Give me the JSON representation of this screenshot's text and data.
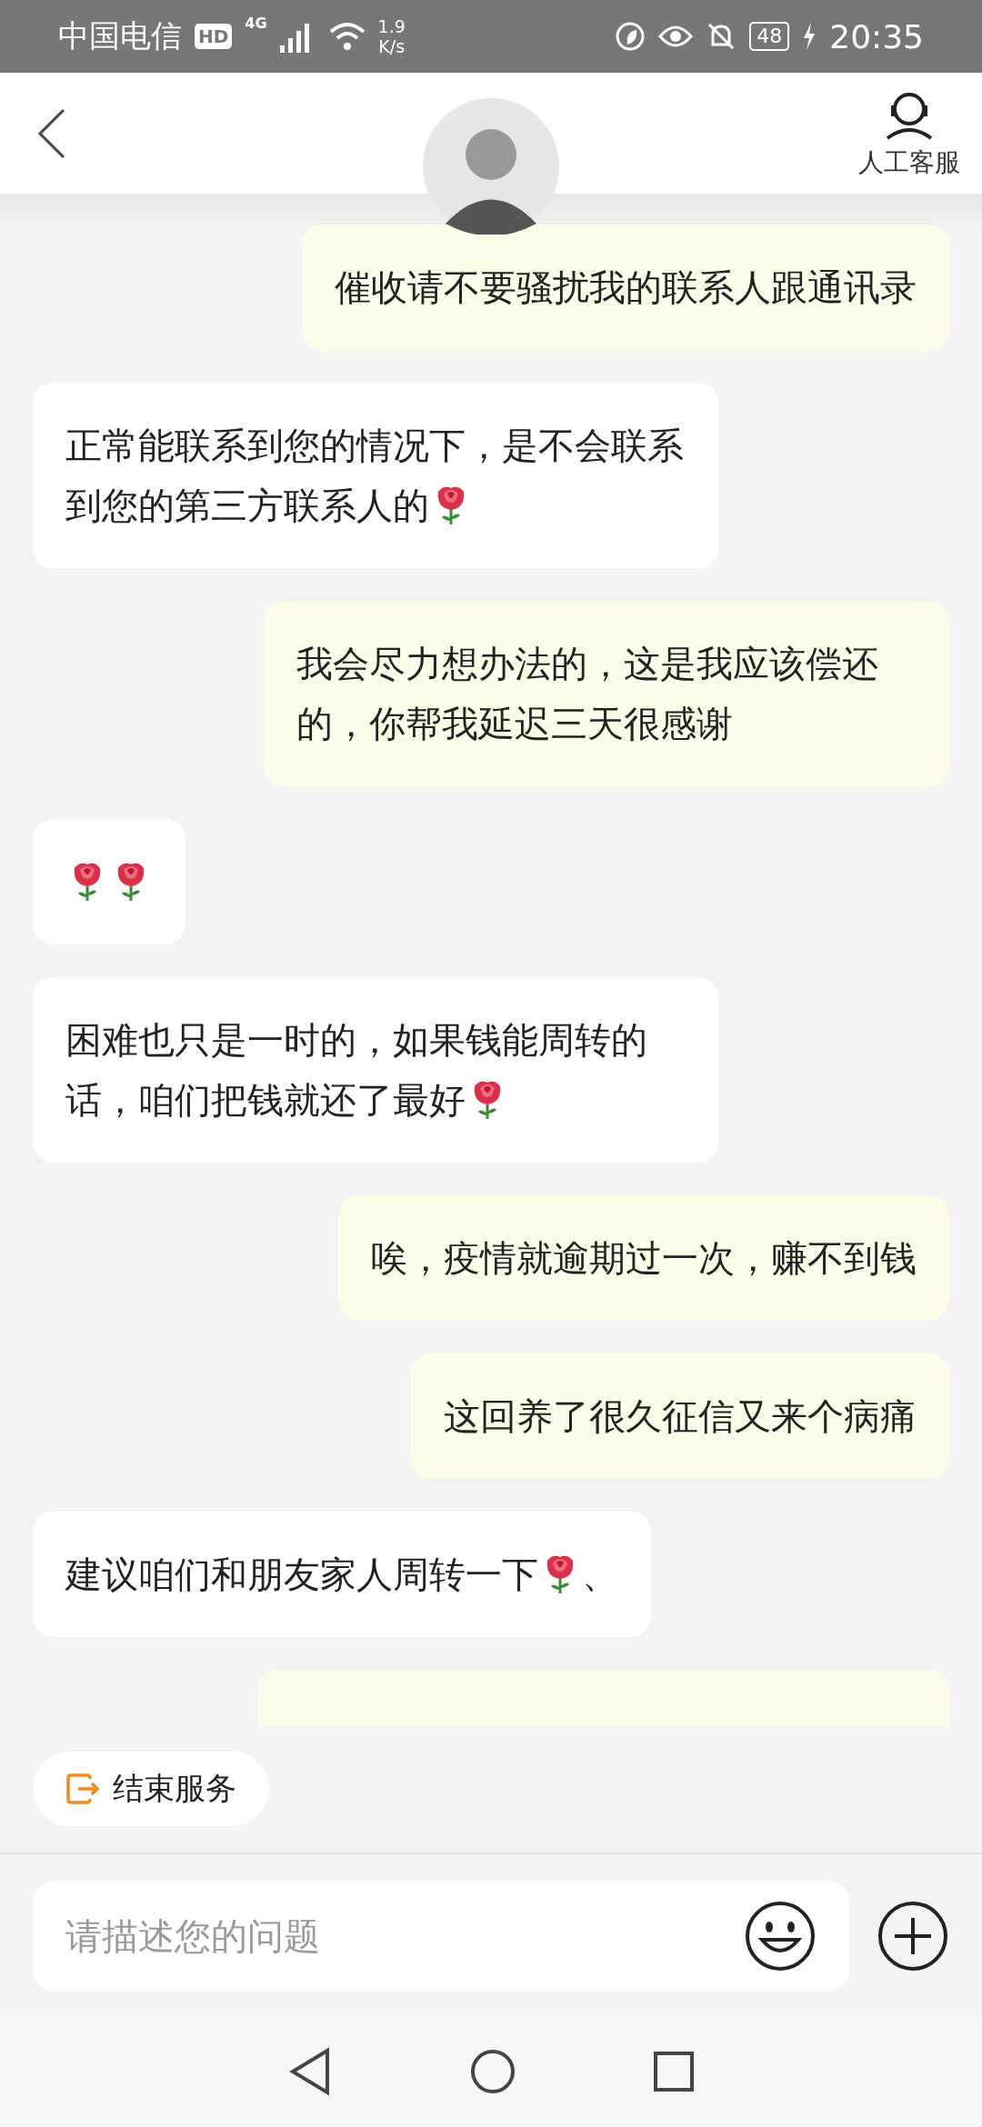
{
  "status_bar": {
    "carrier": "中国电信",
    "hd": "HD",
    "network": "4G",
    "speed_value": "1.9",
    "speed_unit": "K/s",
    "battery": "48",
    "time": "20:35"
  },
  "header": {
    "service_label": "人工客服"
  },
  "messages": [
    {
      "kind": "outgoing",
      "parts": [
        {
          "kind": "text",
          "text": "催收请不要骚扰我的联系人跟通讯录"
        }
      ]
    },
    {
      "kind": "incoming",
      "parts": [
        {
          "kind": "text",
          "text": "正常能联系到您的情况下，是不会联系到您的第三方联系人的"
        },
        {
          "kind": "emoji"
        }
      ]
    },
    {
      "kind": "outgoing",
      "parts": [
        {
          "kind": "text",
          "text": "我会尽力想办法的，这是我应该偿还的，你帮我延迟三天很感谢"
        }
      ]
    },
    {
      "kind": "incoming",
      "parts": [
        {
          "kind": "emoji"
        },
        {
          "kind": "emoji"
        }
      ]
    },
    {
      "kind": "incoming",
      "parts": [
        {
          "kind": "text",
          "text": "困难也只是一时的，如果钱能周转的话，咱们把钱就还了最好"
        },
        {
          "kind": "emoji"
        }
      ]
    },
    {
      "kind": "outgoing",
      "parts": [
        {
          "kind": "text",
          "text": "唉，疫情就逾期过一次，赚不到钱"
        }
      ]
    },
    {
      "kind": "outgoing",
      "parts": [
        {
          "kind": "text",
          "text": "这回养了很久征信又来个病痛"
        }
      ]
    },
    {
      "kind": "incoming",
      "parts": [
        {
          "kind": "text",
          "text": "建议咱们和朋友家人周转一下"
        },
        {
          "kind": "emoji"
        },
        {
          "kind": "text",
          "text": "、"
        }
      ]
    },
    {
      "kind": "outgoing"
    }
  ],
  "end_service": {
    "label": "结束服务"
  },
  "input": {
    "placeholder": "请描述您的问题"
  }
}
